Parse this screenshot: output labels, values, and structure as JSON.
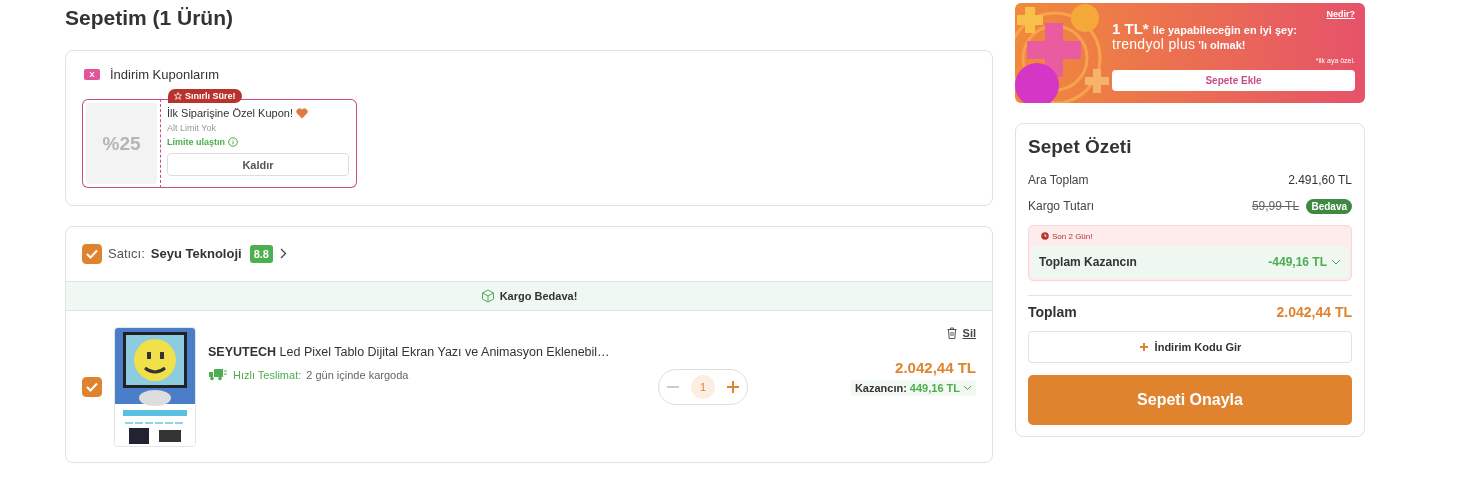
{
  "page_title": "Sepetim (1 Ürün)",
  "coupons": {
    "title": "İndirim Kuponlarım",
    "items": [
      {
        "discount": "%25",
        "badge": "Sınırlı Süre!",
        "name": "İlk Siparişine Özel Kupon!",
        "min_limit": "Alt Limit Yok",
        "status": "Limite ulaştın",
        "action": "Kaldır",
        "applied": true
      }
    ]
  },
  "seller": {
    "checked": true,
    "label": "Satıcı:",
    "name": "Seyu Teknoloji",
    "rating": "8.8",
    "shipping_note": "Kargo Bedava!",
    "items": [
      {
        "checked": true,
        "kind": "picture",
        "title": "**SEYUTECH** Led Pixel Tablo Dijital Ekran Yazı ve Animasyon Eklenebil…",
        "delivery_label": "Hızlı Teslimat:",
        "delivery_text": "2 gün içinde kargoda",
        "quantity": "1",
        "decrease_disabled": true,
        "delete": "Sil",
        "price": "2.042,44 TL",
        "savings_label": "Kazancın:",
        "savings": "449,16 TL"
      }
    ]
  },
  "promo": {
    "link": "Nedir?",
    "headline_price": "1 TL*",
    "headline": "ile yapabileceğin en iyi şey:",
    "brand": "trendyol plus",
    "brand_suffix": "'lı olmak!",
    "note": "*ilk aya özel.",
    "button": "Sepete Ekle"
  },
  "summary": {
    "title": "Sepet Özeti",
    "rows": [
      {
        "label": "Ara Toplam",
        "value": "2.491,60 TL"
      },
      {
        "label": "Kargo Tutarı",
        "old_value": "59,99 TL",
        "badge": "Bedava"
      }
    ],
    "deadline": "Son 2 Gün!",
    "savings_label": "Toplam Kazancın",
    "savings": "-449,16 TL",
    "total_label": "Toplam",
    "total": "2.042,44 TL",
    "code_button": "İndirim Kodu Gir",
    "confirm_button": "Sepeti Onayla"
  }
}
